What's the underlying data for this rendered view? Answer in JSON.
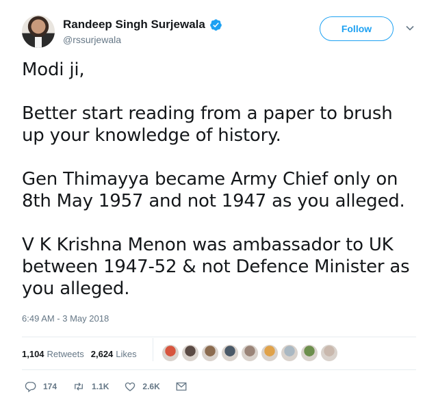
{
  "author": {
    "display_name": "Randeep Singh Surjewala",
    "handle": "@rssurjewala",
    "verified": true
  },
  "follow_button": {
    "label": "Follow"
  },
  "tweet": {
    "paragraphs": [
      "Modi ji,",
      "Better start reading from a paper to brush up your knowledge of history.",
      "Gen Thimayya became Army Chief only on 8th May 1957 and not 1947 as you alleged.",
      "V K Krishna Menon was ambassador to UK between 1947-52 & not Defence Minister as you alleged."
    ],
    "timestamp": "6:49 AM - 3 May 2018"
  },
  "stats": {
    "retweets_count": "1,104",
    "retweets_label": "Retweets",
    "likes_count": "2,624",
    "likes_label": "Likes"
  },
  "likers": [
    {
      "color": "#d7553e"
    },
    {
      "color": "#5a4a44"
    },
    {
      "color": "#8b6b4f"
    },
    {
      "color": "#4a5968"
    },
    {
      "color": "#9a8478"
    },
    {
      "color": "#e0a24a"
    },
    {
      "color": "#aab8c2"
    },
    {
      "color": "#6d8f4d"
    },
    {
      "color": "#c9b8ad"
    }
  ],
  "actions": {
    "replies": "174",
    "retweets": "1.1K",
    "likes": "2.6K"
  },
  "colors": {
    "accent": "#1da1f2",
    "text": "#14171a",
    "muted": "#657786",
    "divider": "#e6ecf0"
  }
}
